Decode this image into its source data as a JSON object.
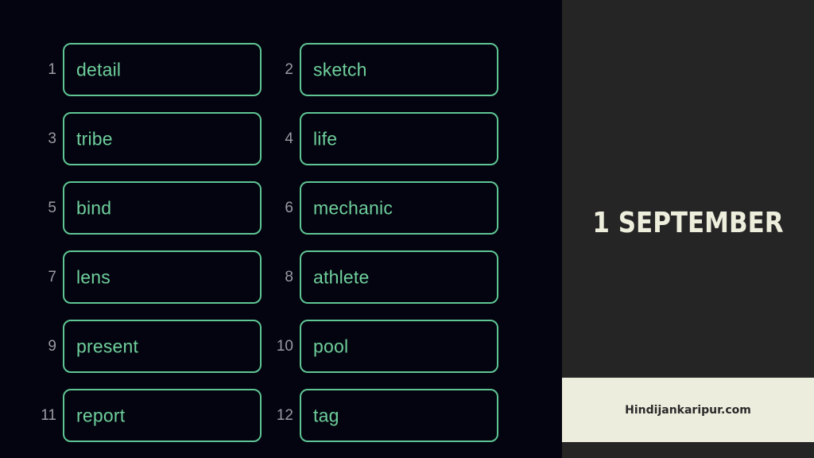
{
  "words": [
    {
      "n": "1",
      "word": "detail"
    },
    {
      "n": "2",
      "word": "sketch"
    },
    {
      "n": "3",
      "word": "tribe"
    },
    {
      "n": "4",
      "word": "life"
    },
    {
      "n": "5",
      "word": "bind"
    },
    {
      "n": "6",
      "word": "mechanic"
    },
    {
      "n": "7",
      "word": "lens"
    },
    {
      "n": "8",
      "word": "athlete"
    },
    {
      "n": "9",
      "word": "present"
    },
    {
      "n": "10",
      "word": "pool"
    },
    {
      "n": "11",
      "word": "report"
    },
    {
      "n": "12",
      "word": "tag"
    }
  ],
  "date": "1 SEPTEMBER",
  "site": "Hindijankaripur.com",
  "colors": {
    "accent_green": "#5fc594",
    "left_bg": "#03040f",
    "right_bg": "#252525",
    "banner_bg": "#ededdd"
  }
}
